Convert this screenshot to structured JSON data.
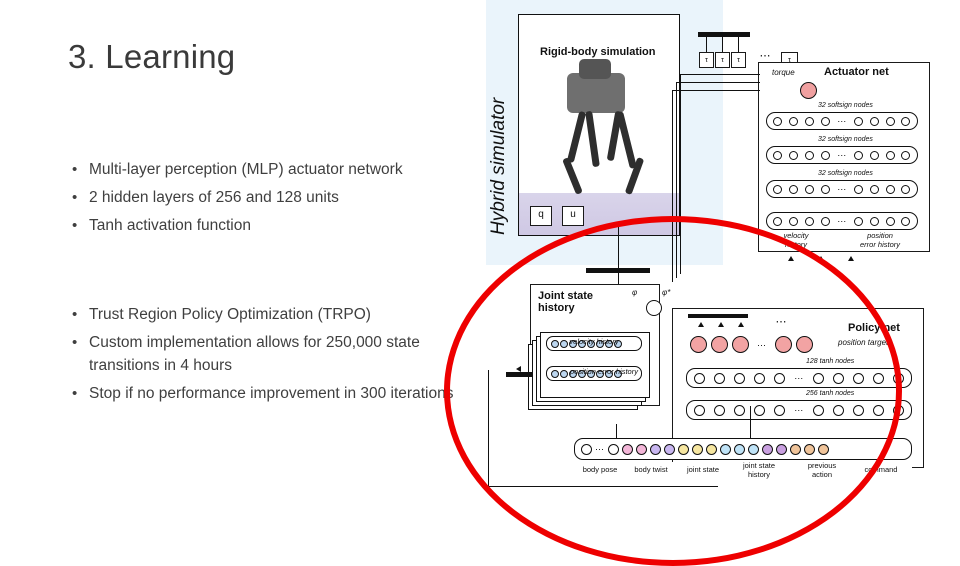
{
  "slide": {
    "title": "3. Learning",
    "bullet_groups": [
      {
        "items": [
          "Multi-layer perception (MLP) actuator network",
          "2 hidden layers of 256 and 128 units",
          "Tanh activation function"
        ]
      },
      {
        "items": [
          "Trust Region Policy Optimization (TRPO)",
          "Custom implementation allows for 250,000 state transitions in 4 hours",
          "Stop if no performance improvement in 300 iterations"
        ]
      }
    ],
    "bullet_marker": "•"
  },
  "figure": {
    "vertical_label": "Hybrid simulator",
    "rigid_body_label": "Rigid-body simulation",
    "actuator_net_label": "Actuator net",
    "torque_label": "torque",
    "time_tokens": [
      "T",
      "τ",
      "τ",
      "τ",
      "⋯",
      "τ"
    ],
    "time_subs": [
      "1",
      "2",
      "3",
      "12"
    ],
    "softsign_rows": [
      "32 softsign nodes",
      "32 softsign nodes",
      "32 softsign nodes"
    ],
    "history_labels": [
      "velocity\nhistory",
      "position\nerror history"
    ],
    "q_label": "q",
    "u_label": "u",
    "joint_state_history_label": "Joint state history",
    "velocity_history_label": "velocity history",
    "position_error_history_label": "position error history",
    "phi_label": "φ",
    "phi_star_label": "φ*",
    "policy_net_label": "Policy net",
    "position_target_label": "position target",
    "tanh_rows": [
      "128 tanh nodes",
      "256 tanh nodes"
    ],
    "input_labels": [
      "body pose",
      "body twist",
      "joint state",
      "joint state history",
      "previous action",
      "command"
    ],
    "ellipsis": "⋯",
    "red_circle_color": "#ee0000",
    "accent_bg": "#eaf4fb"
  }
}
